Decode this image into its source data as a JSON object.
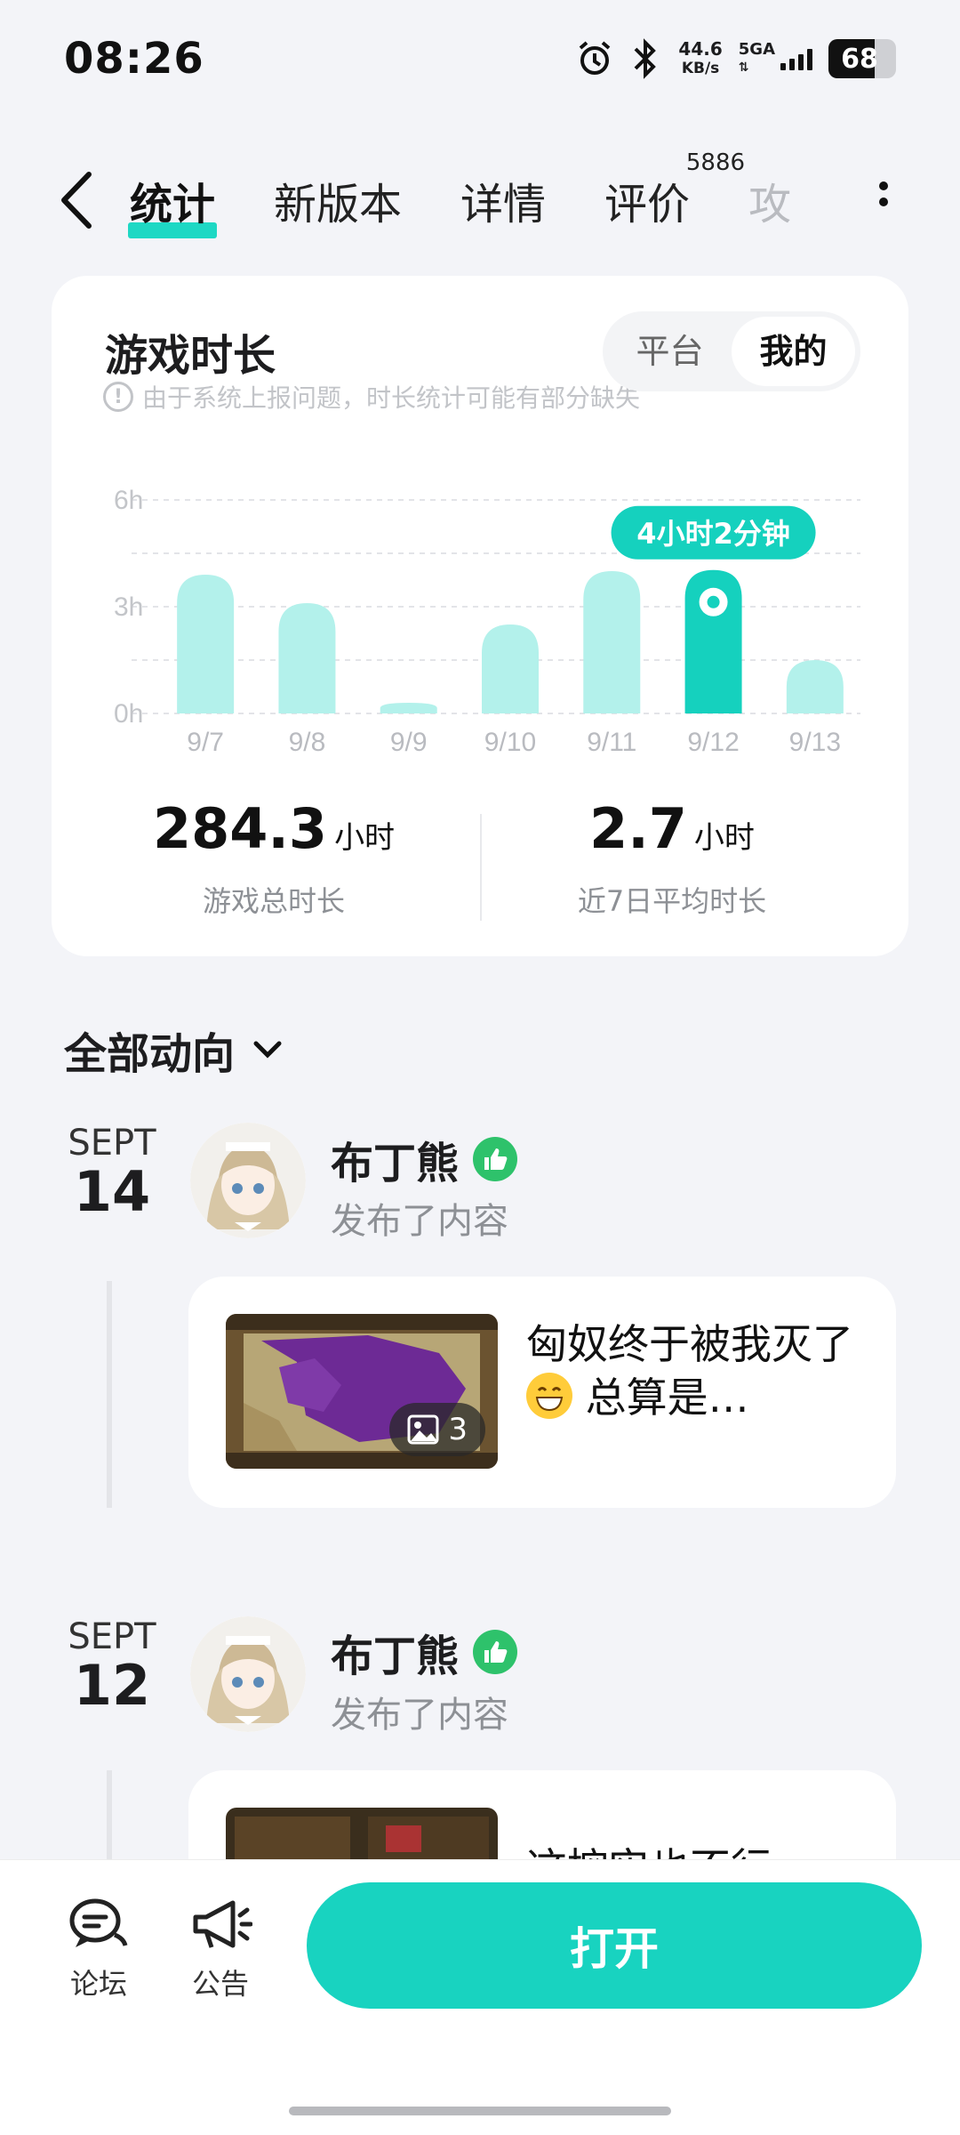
{
  "status_bar": {
    "time": "08:26",
    "net_speed": "44.6",
    "net_unit": "KB/s",
    "signal": "5GA",
    "battery": "68",
    "battery_level": 0.68
  },
  "tabs": [
    {
      "label": "统计",
      "active": true
    },
    {
      "label": "新版本"
    },
    {
      "label": "详情"
    },
    {
      "label": "评价",
      "badge": "5886"
    },
    {
      "label": "攻略"
    }
  ],
  "playtime": {
    "title": "游戏时长",
    "note": "由于系统上报问题，时长统计可能有部分缺失",
    "toggle": [
      "平台",
      "我的"
    ],
    "toggle_selected": "我的",
    "total_value": "284.3",
    "total_unit": "小时",
    "total_label": "游戏总时长",
    "avg_value": "2.7",
    "avg_unit": "小时",
    "avg_label": "近7日平均时长"
  },
  "chart_data": {
    "type": "bar",
    "categories": [
      "9/7",
      "9/8",
      "9/9",
      "9/10",
      "9/11",
      "9/12",
      "9/13"
    ],
    "values": [
      3.9,
      3.1,
      0.3,
      2.5,
      4.0,
      4.03,
      1.5
    ],
    "y_ticks": [
      "0h",
      "3h",
      "6h"
    ],
    "ylim": [
      0,
      6
    ],
    "highlight_index": 5,
    "tooltip": "4小时2分钟",
    "grid": true,
    "colors": {
      "bar": "#b3f1eb",
      "highlight": "#15d1be"
    }
  },
  "feed": {
    "title": "全部动向",
    "items": [
      {
        "month": "SEPT",
        "day": "14",
        "user": "布丁熊",
        "action": "发布了内容",
        "text": "匈奴终于被我灭了",
        "text_tail": " 总算是…",
        "image_count": "3"
      },
      {
        "month": "SEPT",
        "day": "12",
        "user": "布丁熊",
        "action": "发布了内容",
        "text": "这控实也不行"
      }
    ]
  },
  "bottom_bar": {
    "forum": "论坛",
    "notice": "公告",
    "open": "打开"
  },
  "colors": {
    "accent": "#18d3c0",
    "badge_green": "#2ec26b"
  }
}
